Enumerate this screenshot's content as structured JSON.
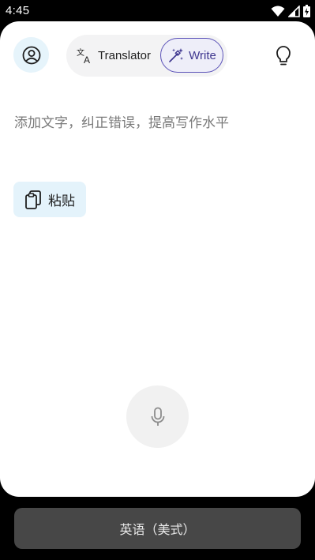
{
  "status_bar": {
    "time": "4:45",
    "icons": [
      "wifi-icon",
      "signal-icon",
      "battery-icon"
    ]
  },
  "header": {
    "profile_icon": "account-circle-icon",
    "tabs": [
      {
        "label": "Translator",
        "icon": "translate-icon",
        "selected": false
      },
      {
        "label": "Write",
        "icon": "magic-wand-icon",
        "selected": true
      }
    ],
    "tips_icon": "lightbulb-icon"
  },
  "editor": {
    "placeholder": "添加文字，纠正错误，提高写作水平",
    "value": ""
  },
  "paste_button": {
    "label": "粘贴",
    "icon": "clipboard-icon"
  },
  "mic_button": {
    "icon": "microphone-icon"
  },
  "language_button": {
    "label": "英语（美式）"
  },
  "colors": {
    "accent": "#5b52b8",
    "accent_bg": "#eeeef9",
    "light_blue": "#e4f3fb",
    "bottom_button": "#474747"
  }
}
